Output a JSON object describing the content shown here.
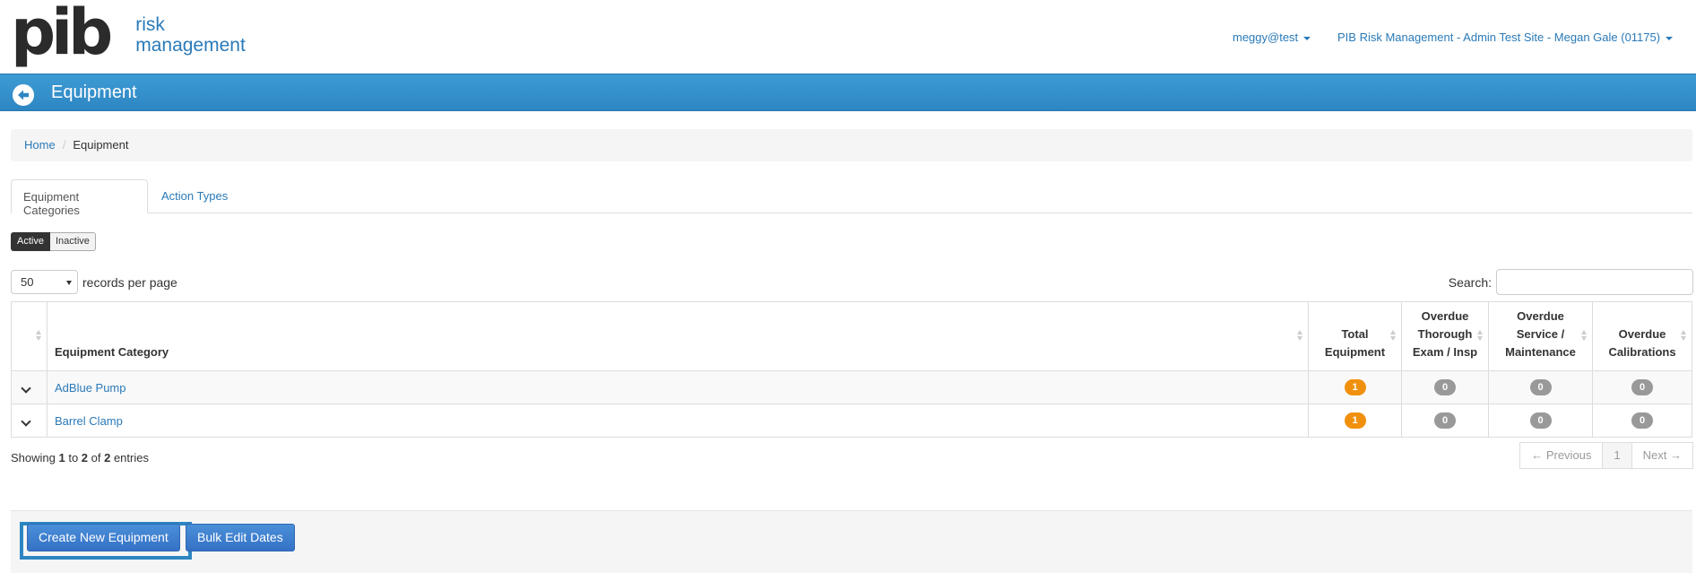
{
  "brand": {
    "mark": "pib",
    "line1": "risk",
    "line2": "management",
    "color": "#2a7ab8"
  },
  "header": {
    "user_menu": "meggy@test",
    "site_menu": "PIB Risk Management - Admin Test Site - Megan Gale (01175)"
  },
  "titlebar": {
    "title": "Equipment",
    "back_icon": "arrow-left-circle-icon",
    "color": "#3d9bd4"
  },
  "breadcrumb": {
    "home": "Home",
    "separator": "/",
    "current": "Equipment"
  },
  "tabs": [
    {
      "label": "Equipment Categories",
      "active": true
    },
    {
      "label": "Action Types",
      "active": false
    }
  ],
  "status_toggle": {
    "active": "Active",
    "inactive": "Inactive",
    "selected": "Active"
  },
  "table_controls": {
    "page_size": "50",
    "page_size_suffix": "records per page",
    "search_label": "Search:",
    "search_value": ""
  },
  "table": {
    "columns": [
      {
        "label": ""
      },
      {
        "label": "Equipment Category"
      },
      {
        "label": "Total Equipment"
      },
      {
        "label": "Overdue Thorough Exam / Insp"
      },
      {
        "label": "Overdue Service / Maintenance"
      },
      {
        "label": "Overdue Calibrations"
      }
    ],
    "rows": [
      {
        "category": "AdBlue Pump",
        "total": "1",
        "overdue_exam": "0",
        "overdue_service": "0",
        "overdue_calibrations": "0"
      },
      {
        "category": "Barrel Clamp",
        "total": "1",
        "overdue_exam": "0",
        "overdue_service": "0",
        "overdue_calibrations": "0"
      }
    ],
    "badge_colors": {
      "total": "#f0900d",
      "overdue": "#999999"
    }
  },
  "info": {
    "prefix": "Showing ",
    "from": "1",
    "to_word": " to ",
    "to": "2",
    "of_word": " of ",
    "total": "2",
    "suffix": " entries"
  },
  "pagination": {
    "previous": "← Previous",
    "page": "1",
    "next": "Next →"
  },
  "footer": {
    "create_button": "Create New Equipment",
    "bulk_button": "Bulk Edit Dates"
  }
}
